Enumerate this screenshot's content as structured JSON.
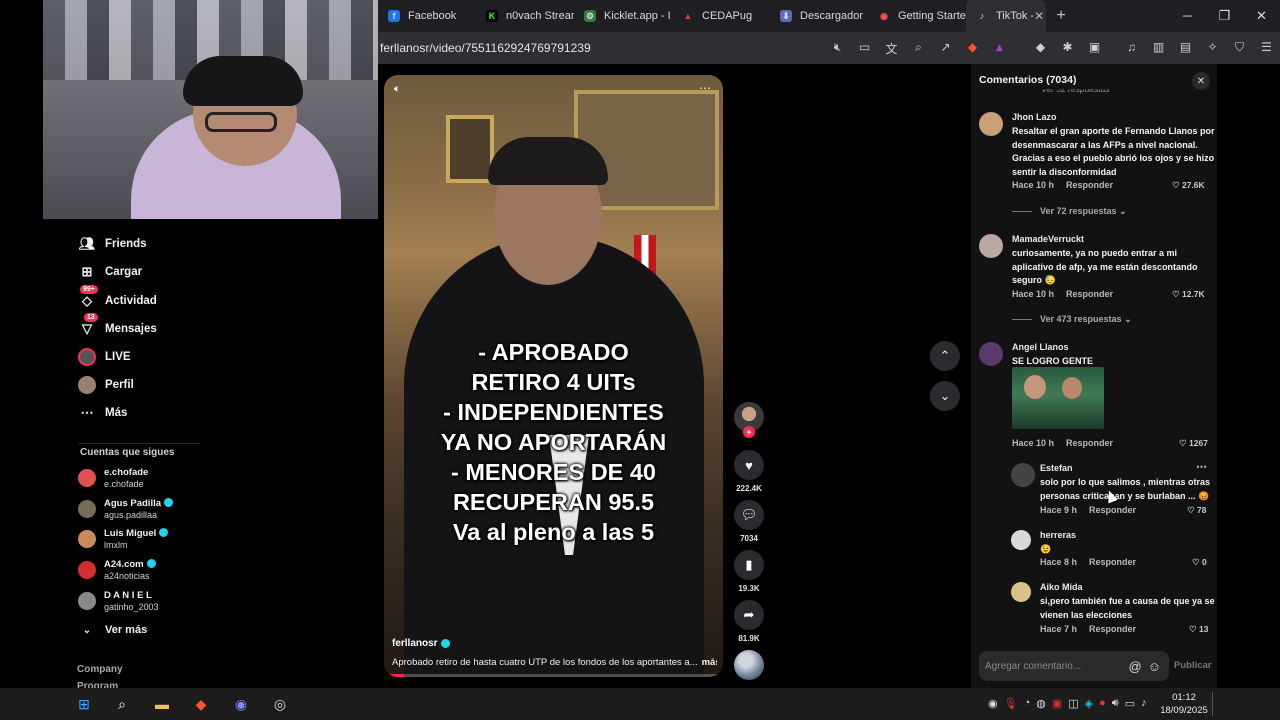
{
  "browser": {
    "tabs": [
      {
        "label": "Facebook",
        "color": "#1877f2",
        "glyph": "f"
      },
      {
        "label": "n0vach Stream",
        "color": "#53fc18",
        "glyph": "K"
      },
      {
        "label": "Kicklet.app - I",
        "color": "#4caf50",
        "glyph": "⚙"
      },
      {
        "label": "CEDAPug",
        "color": "#e53935",
        "glyph": "▲"
      },
      {
        "label": "Descargador",
        "color": "#5c6bc0",
        "glyph": "⬇"
      },
      {
        "label": "Getting Starte",
        "color": "#ff5252",
        "glyph": "◉"
      },
      {
        "label": "TikTok - ",
        "color": "#ffffff",
        "glyph": "♪",
        "active": true
      }
    ],
    "url": "ferllanosr/video/7551162924769791239"
  },
  "leftnav": {
    "items": [
      {
        "label": "Friends",
        "icon": "friends-icon",
        "glyph": "☺"
      },
      {
        "label": "Cargar",
        "icon": "upload-icon",
        "glyph": "⊞"
      },
      {
        "label": "Actividad",
        "icon": "activity-icon",
        "glyph": "◇",
        "badge": "99+"
      },
      {
        "label": "Mensajes",
        "icon": "messages-icon",
        "glyph": "▽",
        "badge": "13"
      },
      {
        "label": "LIVE",
        "icon": "live-icon",
        "glyph": "●"
      },
      {
        "label": "Perfil",
        "icon": "profile-icon",
        "glyph": "◎"
      },
      {
        "label": "Más",
        "icon": "more-icon",
        "glyph": "…"
      }
    ],
    "following_title": "Cuentas que sigues",
    "following": [
      {
        "name": "e.chofade",
        "user": "e.chofade",
        "verified": false,
        "color": "#e05050"
      },
      {
        "name": "Agus Padilla",
        "user": "agus.padillaa",
        "verified": true,
        "color": "#7a6a5a"
      },
      {
        "name": "Luis Miguel",
        "user": "lmxlm",
        "verified": true,
        "color": "#c98a60"
      },
      {
        "name": "A24.com",
        "user": "a24noticias",
        "verified": true,
        "color": "#d32f2f"
      },
      {
        "name": "D A N I E L",
        "user": "gatinho_2003",
        "verified": false,
        "color": "#888888"
      }
    ],
    "see_more": "Ver más",
    "footer": [
      "Company",
      "Program"
    ]
  },
  "video": {
    "caption_lines": [
      "- APROBADO",
      "RETIRO 4 UITs",
      "- INDEPENDIENTES",
      "YA NO APORTARÁN",
      "- MENORES DE 40",
      "RECUPERAN 95.5",
      "Va al pleno a las 5"
    ],
    "author": "ferllanosr",
    "description": "Aprobado retiro de hasta cuatro UTP de los fondos de los aportantes a...",
    "more": "más",
    "progress": 0.06
  },
  "actions": {
    "likes": "222.4K",
    "comments": "7034",
    "saves": "19.3K",
    "shares": "81.9K"
  },
  "comments_panel": {
    "title": "Comentarios (7034)",
    "partial_replies": "Ver 52 respuestas",
    "comments": [
      {
        "name": "Jhon Lazo",
        "text": "Resaltar el gran aporte de Fernando Llanos por desenmascarar a las AFPs a nivel nacional. Gracias a eso el pueblo abrió los ojos y se hizo sentir la disconformidad",
        "time": "Hace 10 h",
        "reply": "Responder",
        "likes": "27.6K",
        "replies": "Ver 72 respuestas",
        "color": "#c9a07a"
      },
      {
        "name": "MamadeVerruckt",
        "text": "curiosamente, ya no puedo entrar a mi aplicativo de afp, ya me están descontando seguro 😓",
        "time": "Hace 10 h",
        "reply": "Responder",
        "likes": "12.7K",
        "replies": "Ver 473 respuestas",
        "color": "#b9a9a0"
      },
      {
        "name": "Angel Llanos",
        "text": "SE LOGRO GENTE",
        "time": "Hace 10 h",
        "reply": "Responder",
        "likes": "1267",
        "color": "#5a3a6a"
      },
      {
        "name": "Estefan",
        "text": "solo por lo que salimos , mientras otras personas criticaban y se burlaban ... 😡",
        "time": "Hace 9 h",
        "reply": "Responder",
        "likes": "78",
        "color": "#444444"
      },
      {
        "name": "herreras",
        "text": "😉",
        "time": "Hace 8 h",
        "reply": "Responder",
        "likes": "0",
        "color": "#d8d8d8"
      },
      {
        "name": "Aiko Mida",
        "text": "si,pero también fue a causa de que ya se vienen las elecciones",
        "time": "Hace 7 h",
        "reply": "Responder",
        "likes": "13",
        "color": "#d8c28a"
      }
    ],
    "input_placeholder": "Agregar comentario...",
    "publish": "Publicar"
  },
  "taskbar": {
    "time": "01:12",
    "date": "18/09/2025"
  }
}
